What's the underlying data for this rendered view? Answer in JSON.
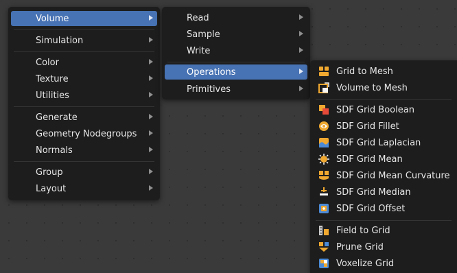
{
  "main_menu": {
    "items": [
      {
        "label": "Volume",
        "submenu": true,
        "active": true
      },
      {
        "label": "Simulation",
        "submenu": true
      },
      {
        "label": "Color",
        "submenu": true
      },
      {
        "label": "Texture",
        "submenu": true
      },
      {
        "label": "Utilities",
        "submenu": true
      },
      {
        "label": "Generate",
        "submenu": true
      },
      {
        "label": "Geometry Nodegroups",
        "submenu": true
      },
      {
        "label": "Normals",
        "submenu": true
      },
      {
        "label": "Group",
        "submenu": true
      },
      {
        "label": "Layout",
        "submenu": true
      }
    ]
  },
  "volume_menu": {
    "items": [
      {
        "label": "Read",
        "submenu": true
      },
      {
        "label": "Sample",
        "submenu": true
      },
      {
        "label": "Write",
        "submenu": true
      },
      {
        "label": "Operations",
        "submenu": true,
        "active": true
      },
      {
        "label": "Primitives",
        "submenu": true
      }
    ]
  },
  "operations_menu": {
    "items": [
      {
        "label": "Grid to Mesh",
        "icon": "node-icon"
      },
      {
        "label": "Volume to Mesh",
        "icon": "volume-to-mesh-icon"
      },
      {
        "label": "SDF Grid Boolean",
        "icon": "boolean-icon"
      },
      {
        "label": "SDF Grid Fillet",
        "icon": "fillet-icon"
      },
      {
        "label": "SDF Grid Laplacian",
        "icon": "laplacian-icon"
      },
      {
        "label": "SDF Grid Mean",
        "icon": "mean-icon"
      },
      {
        "label": "SDF Grid Mean Curvature",
        "icon": "mean-curvature-icon"
      },
      {
        "label": "SDF Grid Median",
        "icon": "median-icon"
      },
      {
        "label": "SDF Grid Offset",
        "icon": "offset-icon"
      },
      {
        "label": "Field to Grid",
        "icon": "field-to-grid-icon"
      },
      {
        "label": "Prune Grid",
        "icon": "prune-icon"
      },
      {
        "label": "Voxelize Grid",
        "icon": "voxelize-icon"
      }
    ]
  },
  "colors": {
    "menu_bg": "#1d1d1d",
    "active_bg": "#4772b3",
    "canvas_bg": "#3a3a3a",
    "text": "#e6e6e6",
    "icon_orange": "#f0a830",
    "icon_blue": "#4c8ad6"
  }
}
